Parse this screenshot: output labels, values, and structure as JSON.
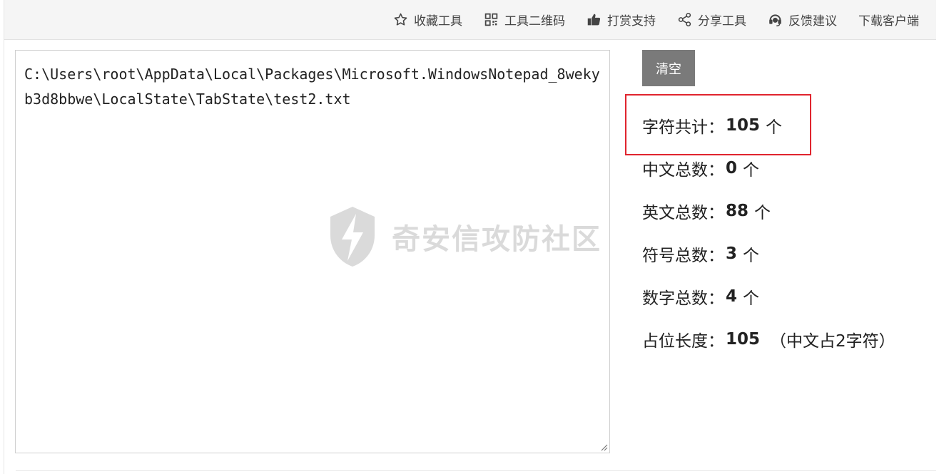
{
  "nav": {
    "items": [
      {
        "label": "收藏工具",
        "icon": "star-icon"
      },
      {
        "label": "工具二维码",
        "icon": "qrcode-icon"
      },
      {
        "label": "打赏支持",
        "icon": "thumbs-up-icon"
      },
      {
        "label": "分享工具",
        "icon": "share-icon"
      },
      {
        "label": "反馈建议",
        "icon": "headset-icon"
      },
      {
        "label": "下载客户端",
        "icon": ""
      }
    ]
  },
  "editor": {
    "value": "C:\\Users\\root\\AppData\\Local\\Packages\\Microsoft.WindowsNotepad_8wekyb3d8bbwe\\LocalState\\TabState\\test2.txt"
  },
  "watermark": {
    "text": "奇安信攻防社区",
    "icon": "lightning-shield-icon"
  },
  "clear_button": {
    "label": "清空"
  },
  "stats": {
    "total": {
      "label": "字符共计：",
      "value": "105",
      "unit": "个"
    },
    "chinese": {
      "label": "中文总数：",
      "value": "0",
      "unit": "个"
    },
    "english": {
      "label": "英文总数：",
      "value": "88",
      "unit": "个"
    },
    "symbols": {
      "label": "符号总数：",
      "value": "3",
      "unit": "个"
    },
    "digits": {
      "label": "数字总数：",
      "value": "4",
      "unit": "个"
    },
    "length": {
      "label": "占位长度：",
      "value": "105",
      "note": "（中文占2字符）"
    }
  },
  "colors": {
    "highlight": "#e0242e",
    "button_bg": "#7a7a7a",
    "topbar_bg": "#f5f5f5"
  }
}
